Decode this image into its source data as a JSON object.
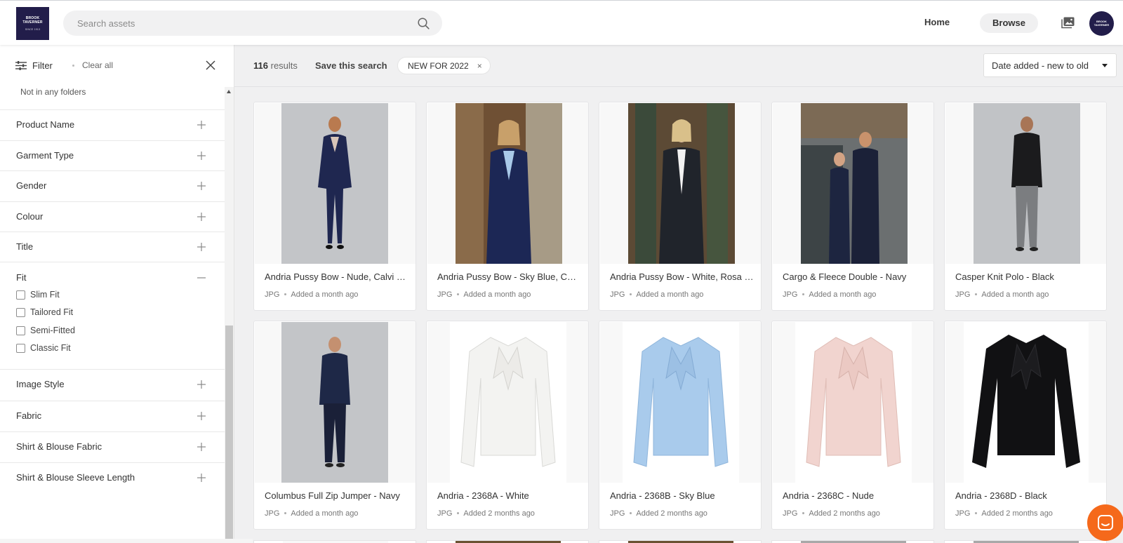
{
  "header": {
    "logo_line1": "BROOK",
    "logo_line2": "TAVERNER",
    "logo_sub": "SINCE 1913",
    "search_placeholder": "Search assets",
    "nav_home": "Home",
    "nav_browse": "Browse",
    "avatar_line1": "BROOK",
    "avatar_line2": "TAVERNER"
  },
  "sidebar": {
    "filter_label": "Filter",
    "clear_all": "Clear all",
    "not_in_folders": "Not in any folders",
    "facets": [
      {
        "label": "Product Name",
        "expanded": false
      },
      {
        "label": "Garment Type",
        "expanded": false
      },
      {
        "label": "Gender",
        "expanded": false
      },
      {
        "label": "Colour",
        "expanded": false
      },
      {
        "label": "Title",
        "expanded": false
      },
      {
        "label": "Fit",
        "expanded": true
      },
      {
        "label": "Image Style",
        "expanded": false
      },
      {
        "label": "Fabric",
        "expanded": false
      },
      {
        "label": "Shirt & Blouse Fabric",
        "expanded": false
      },
      {
        "label": "Shirt & Blouse Sleeve Length",
        "expanded": false
      }
    ],
    "fit_options": [
      "Slim Fit",
      "Tailored Fit",
      "Semi-Fitted",
      "Classic Fit"
    ]
  },
  "toolbar": {
    "results_count": "116",
    "results_label": "results",
    "save_search": "Save this search",
    "chip_label": "NEW FOR 2022",
    "chip_close": "×",
    "sort_label": "Date added - new to old"
  },
  "assets": [
    {
      "title": "Andria Pussy Bow - Nude, Calvi J...",
      "format": "JPG",
      "added": "Added a month ago"
    },
    {
      "title": "Andria Pussy Bow - Sky Blue, Cal...",
      "format": "JPG",
      "added": "Added a month ago"
    },
    {
      "title": "Andria Pussy Bow - White, Rosa J...",
      "format": "JPG",
      "added": "Added a month ago"
    },
    {
      "title": "Cargo & Fleece Double - Navy",
      "format": "JPG",
      "added": "Added a month ago"
    },
    {
      "title": "Casper Knit Polo - Black",
      "format": "JPG",
      "added": "Added a month ago"
    },
    {
      "title": "Columbus Full Zip Jumper - Navy",
      "format": "JPG",
      "added": "Added a month ago"
    },
    {
      "title": "Andria - 2368A - White",
      "format": "JPG",
      "added": "Added 2 months ago"
    },
    {
      "title": "Andria - 2368B - Sky Blue",
      "format": "JPG",
      "added": "Added 2 months ago"
    },
    {
      "title": "Andria - 2368C - Nude",
      "format": "JPG",
      "added": "Added 2 months ago"
    },
    {
      "title": "Andria - 2368D - Black",
      "format": "JPG",
      "added": "Added 2 months ago"
    }
  ],
  "colors": {
    "brand_navy": "#221d4a",
    "chat_orange": "#f5691b",
    "main_bg": "#f0f0f1"
  }
}
